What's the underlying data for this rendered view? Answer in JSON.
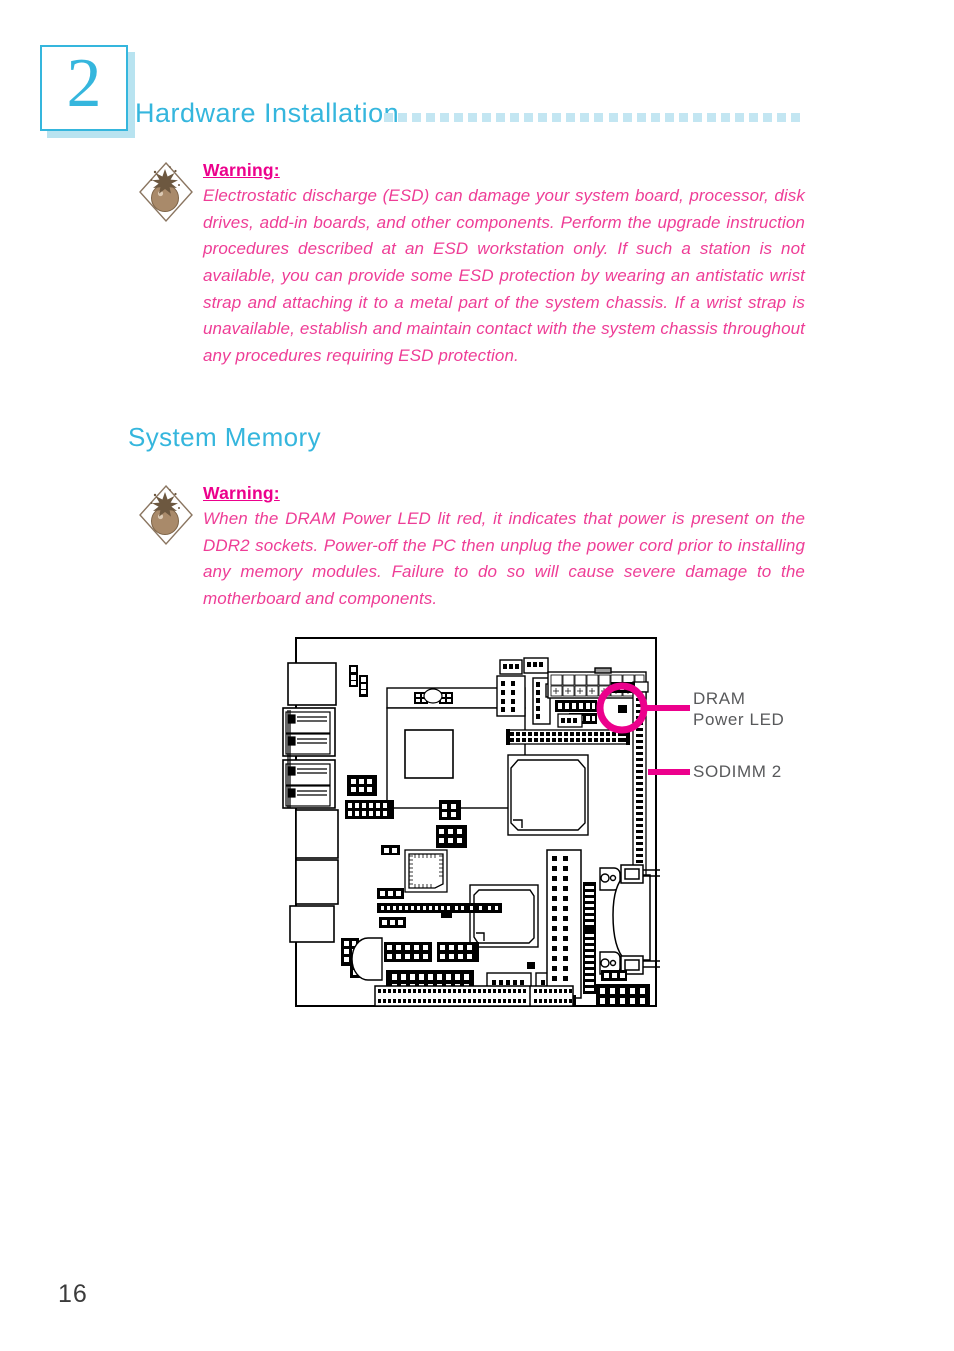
{
  "header": {
    "chapter_number": "2",
    "title": "Hardware Installation",
    "dot_count": 30,
    "accent_color": "#35b6dd",
    "dot_color": "#c3e6f2"
  },
  "warnings": [
    {
      "id": "esd",
      "icon": "bomb-warning-icon",
      "title": "Warning:",
      "text": "Electrostatic discharge (ESD) can damage your system board, processor, disk drives, add-in boards, and other components. Perform the upgrade instruction procedures described at an ESD workstation only. If such a station is not available, you can provide some ESD protection by wearing an antistatic wrist strap and attaching it to a metal part of the system chassis. If a wrist strap is unavailable, establish and maintain contact with the system chassis throughout any procedures requiring ESD protection.",
      "title_color": "#ec008c",
      "text_color": "#ee3d96"
    },
    {
      "id": "dram",
      "icon": "bomb-warning-icon",
      "title": "Warning:",
      "text": "When the DRAM Power LED lit red, it indicates that power is present on the DDR2 sockets. Power-off the PC then unplug the power cord prior to installing any memory modules. Failure to do so will cause severe damage to the motherboard and components.",
      "title_color": "#ec008c",
      "text_color": "#ee3d96"
    }
  ],
  "section": {
    "heading": "System Memory"
  },
  "figure": {
    "name": "system-board-diagram",
    "callouts": [
      {
        "label_line1": "DRAM",
        "label_line2": "Power  LED",
        "highlight": "circle"
      },
      {
        "label_line1": "SODIMM  2",
        "label_line2": "",
        "highlight": "line"
      }
    ],
    "highlight_color": "#ec008c",
    "label_color": "#58595b"
  },
  "footer": {
    "page_number": "16"
  }
}
